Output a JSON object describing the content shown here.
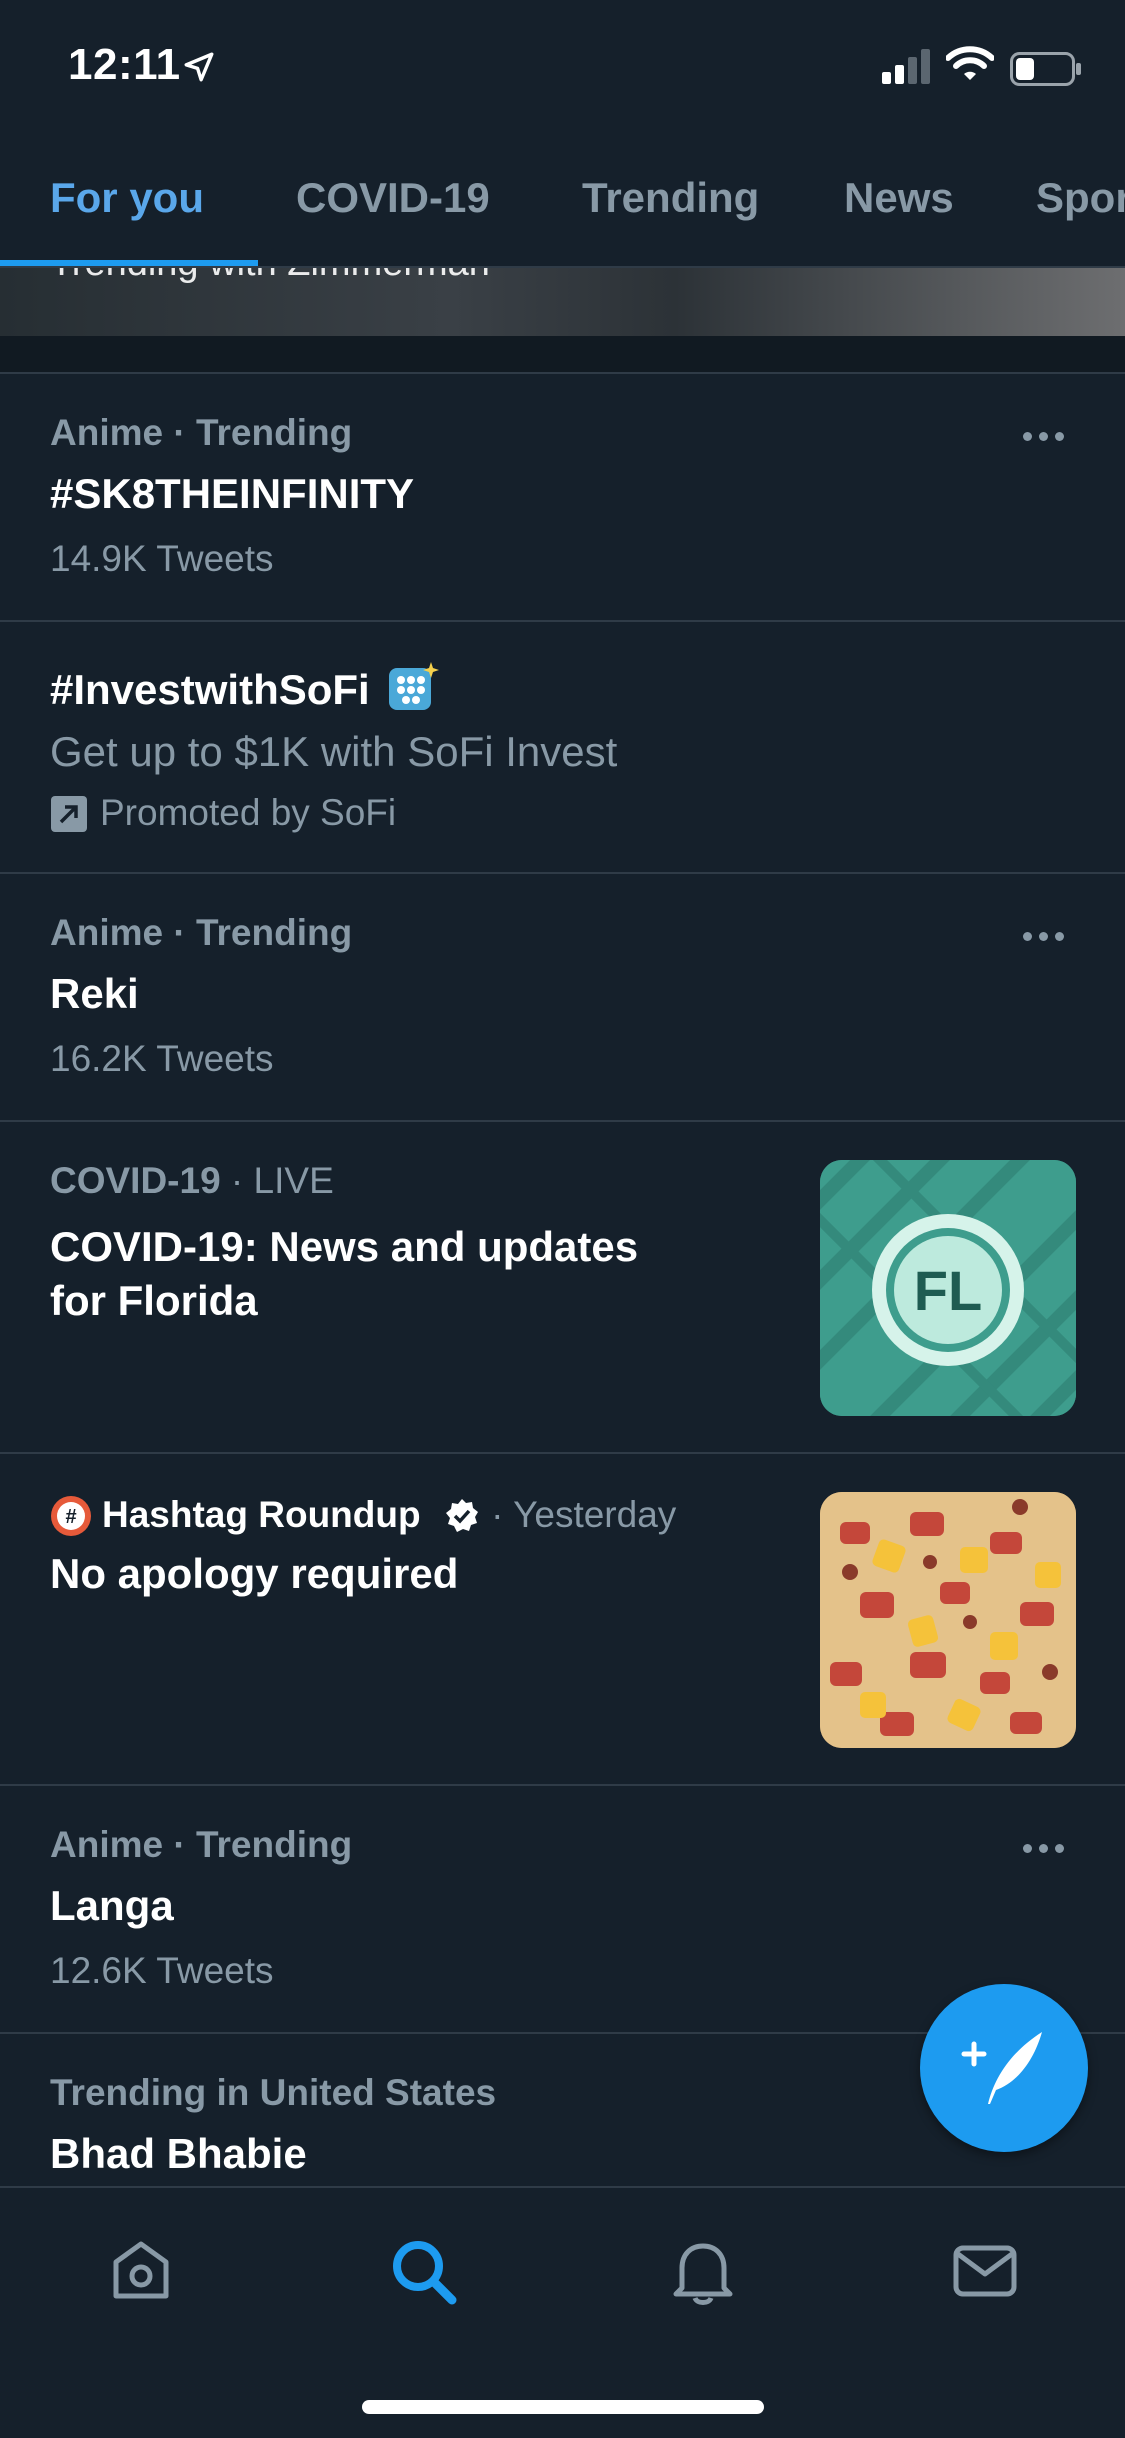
{
  "status_bar": {
    "time": "12:11"
  },
  "tabs": [
    {
      "label": "For you",
      "active": true
    },
    {
      "label": "COVID-19",
      "active": false
    },
    {
      "label": "Trending",
      "active": false
    },
    {
      "label": "News",
      "active": false
    },
    {
      "label": "Spor",
      "active": false
    }
  ],
  "hero": {
    "caption": "Trending with Zimmerman"
  },
  "trends": [
    {
      "meta": "Anime · Trending",
      "title": "#SK8THEINFINITY",
      "count": "14.9K Tweets"
    },
    {
      "title": "#InvestwithSoFi",
      "subtitle": "Get up to $1K with SoFi Invest",
      "promoted": "Promoted by SoFi"
    },
    {
      "meta": "Anime · Trending",
      "title": "Reki",
      "count": "16.2K Tweets"
    },
    {
      "meta_category": "COVID-19",
      "meta_live": " · LIVE",
      "title_line1": "COVID-19: News and updates",
      "title_line2": "for Florida",
      "thumb_text": "FL"
    },
    {
      "author": "Hashtag Roundup",
      "time": " · Yesterday",
      "title": "No apology required"
    },
    {
      "meta": "Anime · Trending",
      "title": "Langa",
      "count": "12.6K Tweets"
    },
    {
      "meta": "Trending in United States",
      "title": "Bhad Bhabie"
    }
  ],
  "colors": {
    "background": "#15202b",
    "accent": "#1d9bf0",
    "muted": "#8899a6",
    "divider": "#2f3b47"
  },
  "icons": [
    "location-arrow-icon",
    "signal-icon",
    "wifi-icon",
    "battery-icon",
    "more-icon",
    "promoted-icon",
    "verified-icon",
    "compose-icon",
    "home-icon",
    "search-icon",
    "notifications-icon",
    "messages-icon"
  ]
}
